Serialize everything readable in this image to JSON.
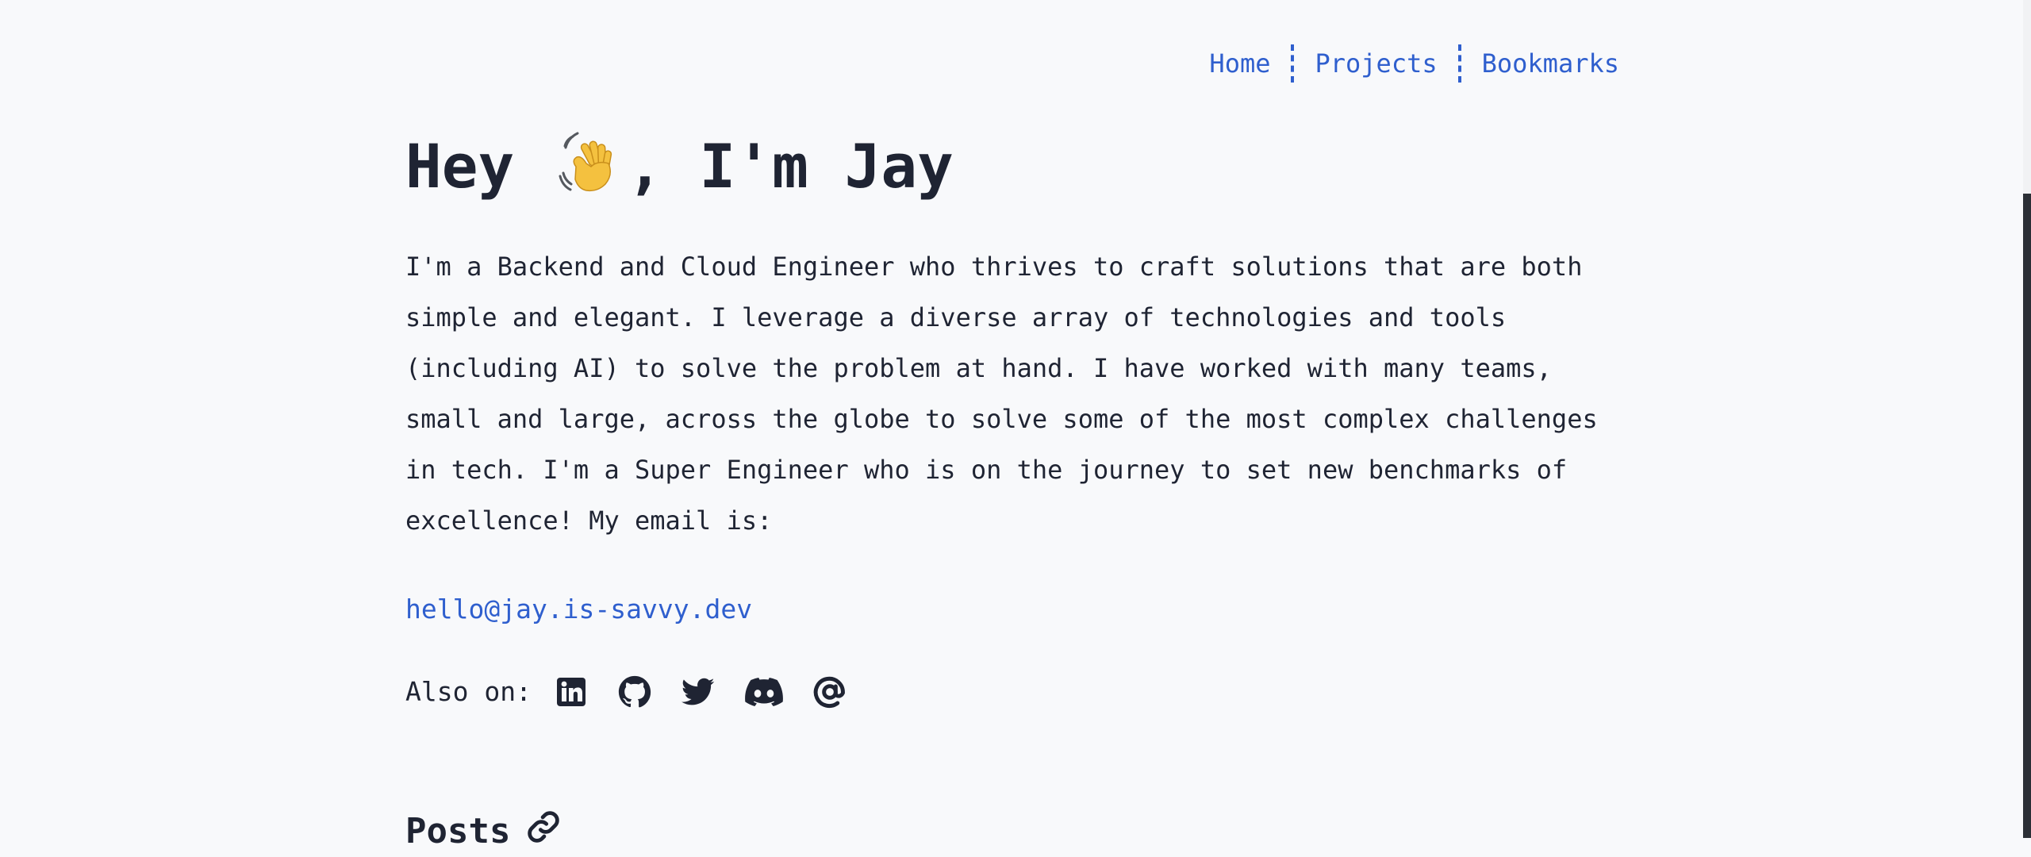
{
  "nav": {
    "items": [
      {
        "label": "Home"
      },
      {
        "label": "Projects"
      },
      {
        "label": "Bookmarks"
      }
    ]
  },
  "hero": {
    "title_prefix": "Hey",
    "title_suffix": ", I'm Jay",
    "wave_icon": "waving-hand-emoji"
  },
  "bio": {
    "text": "I'm a Backend and Cloud Engineer who thrives to craft solutions that are both simple and elegant. I leverage a diverse array of technologies and tools (including AI) to solve the problem at hand. I have worked with many teams, small and large, across the globe to solve some of the most complex challenges in tech. I'm a Super Engineer who is on the journey to set new benchmarks of excellence! My email is:",
    "email": "hello@jay.is-savvy.dev"
  },
  "social": {
    "label": "Also on:",
    "icons": [
      "linkedin-icon",
      "github-icon",
      "twitter-icon",
      "discord-icon",
      "at-sign-icon"
    ]
  },
  "posts": {
    "heading": "Posts",
    "icon": "link-icon"
  },
  "colors": {
    "background": "#f8f9fb",
    "text": "#1f2433",
    "link": "#2f5fce"
  }
}
